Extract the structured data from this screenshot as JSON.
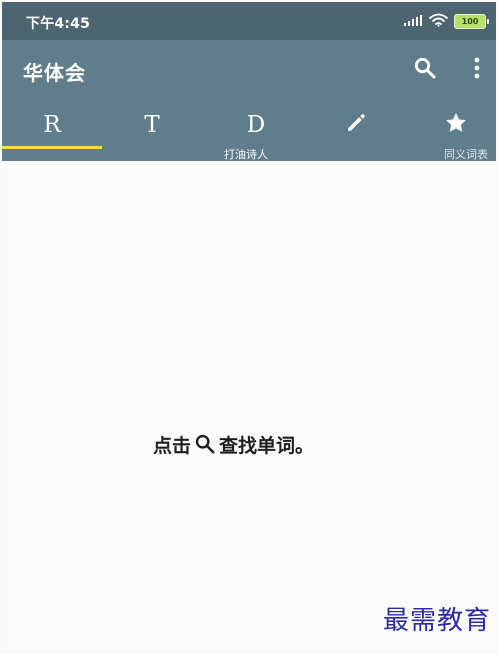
{
  "status_bar": {
    "time": "下午4:45",
    "battery": "100",
    "icons": [
      "signal-icon",
      "wifi-icon",
      "battery-icon"
    ]
  },
  "app_bar": {
    "title": "华体会",
    "actions": [
      "search-icon",
      "more-icon"
    ]
  },
  "tabs": [
    {
      "label": "R",
      "selected": true
    },
    {
      "label": "T",
      "selected": false
    },
    {
      "label": "D",
      "selected": false
    },
    {
      "icon": "pencil-icon",
      "selected": false
    },
    {
      "icon": "star-icon",
      "selected": false
    }
  ],
  "subtabs": {
    "poet": "打油诗人",
    "synonym": "同义词表"
  },
  "content": {
    "hint_prefix": "点击",
    "hint_icon": "search-icon",
    "hint_suffix": "查找单词。"
  },
  "watermark": {
    "text": "最需教育"
  },
  "colors": {
    "status_bar": "#4d6571",
    "app_bar": "#607d8b",
    "selected_indicator": "#ffdf3a",
    "content_background": "#fbfbfb",
    "hint_text": "#1f1f1f",
    "watermark": "#2d2aa8"
  }
}
